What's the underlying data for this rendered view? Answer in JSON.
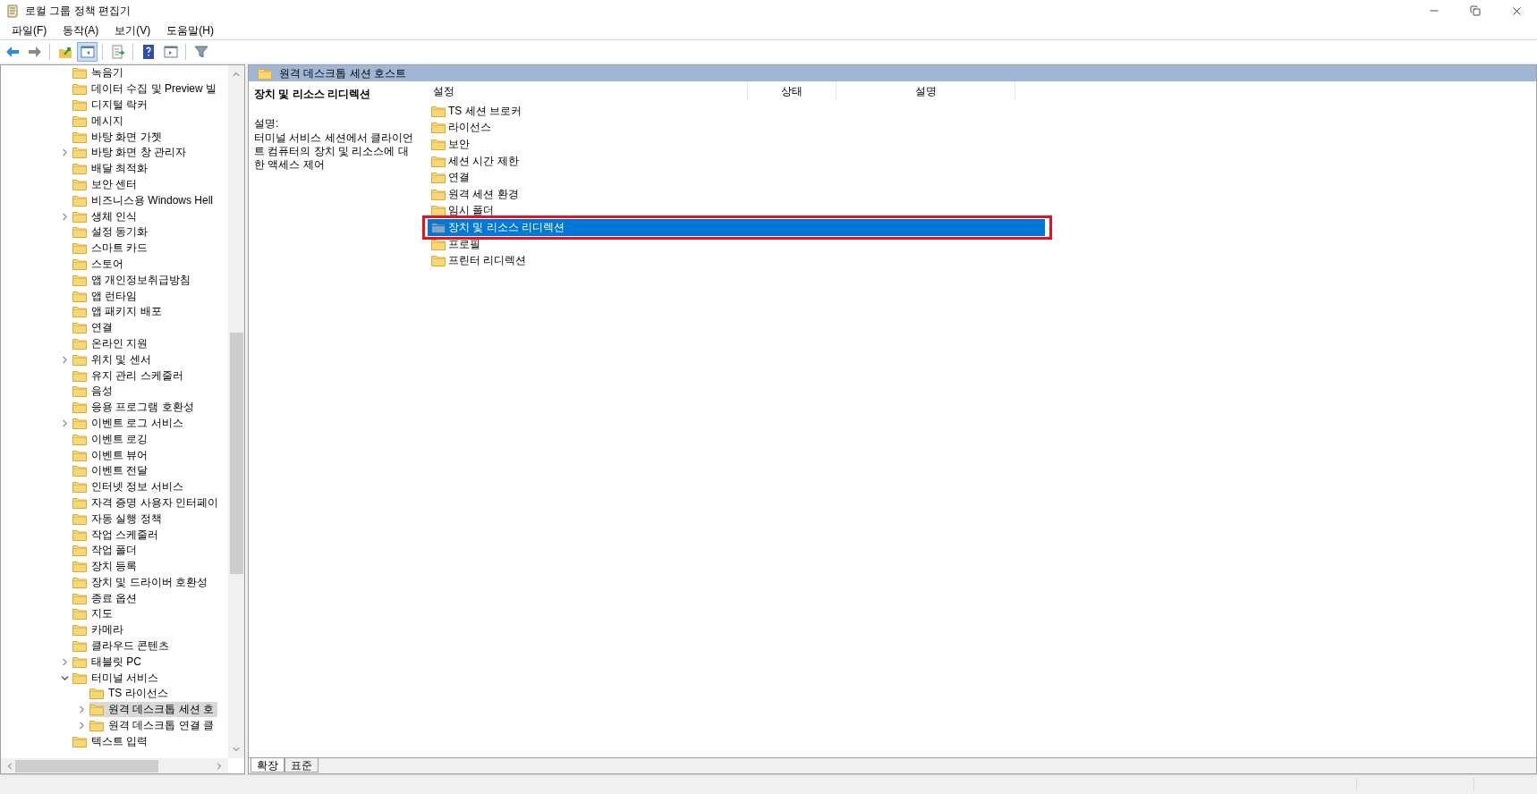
{
  "window": {
    "title": "로컬 그룹 정책 편집기"
  },
  "menu": [
    "파일(F)",
    "동작(A)",
    "보기(V)",
    "도움말(H)"
  ],
  "toolbar": [
    {
      "buttons": [
        {
          "kind": "back",
          "pressed": false
        },
        {
          "kind": "forward",
          "pressed": false
        }
      ]
    },
    {
      "buttons": [
        {
          "kind": "up",
          "pressed": false
        },
        {
          "kind": "tree-pane",
          "pressed": true
        }
      ]
    },
    {
      "buttons": [
        {
          "kind": "export",
          "pressed": false
        }
      ]
    },
    {
      "buttons": [
        {
          "kind": "help",
          "pressed": false
        },
        {
          "kind": "action-pane",
          "pressed": false
        }
      ]
    },
    {
      "buttons": [
        {
          "kind": "filter",
          "pressed": false
        }
      ]
    }
  ],
  "tree": [
    {
      "label": "녹음기",
      "expandable": false,
      "selected": false
    },
    {
      "label": "데이터 수집 및 Preview 빌",
      "expandable": false,
      "selected": false
    },
    {
      "label": "디지털 락커",
      "expandable": false,
      "selected": false
    },
    {
      "label": "메시지",
      "expandable": false,
      "selected": false
    },
    {
      "label": "바탕 화면 가젯",
      "expandable": false,
      "selected": false
    },
    {
      "label": "바탕 화면 창 관리자",
      "expandable": true,
      "expanded": false,
      "selected": false
    },
    {
      "label": "배달 최적화",
      "expandable": false,
      "selected": false
    },
    {
      "label": "보안 센터",
      "expandable": false,
      "selected": false
    },
    {
      "label": "비즈니스용 Windows Hell",
      "expandable": false,
      "selected": false
    },
    {
      "label": "생체 인식",
      "expandable": true,
      "expanded": false,
      "selected": false
    },
    {
      "label": "설정 동기화",
      "expandable": false,
      "selected": false
    },
    {
      "label": "스마트 카드",
      "expandable": false,
      "selected": false
    },
    {
      "label": "스토어",
      "expandable": false,
      "selected": false
    },
    {
      "label": "앱 개인정보취급방침",
      "expandable": false,
      "selected": false
    },
    {
      "label": "앱 런타임",
      "expandable": false,
      "selected": false
    },
    {
      "label": "앱 패키지 배포",
      "expandable": false,
      "selected": false
    },
    {
      "label": "연결",
      "expandable": false,
      "selected": false
    },
    {
      "label": "온라인 지원",
      "expandable": false,
      "selected": false
    },
    {
      "label": "위치 및 센서",
      "expandable": true,
      "expanded": false,
      "selected": false
    },
    {
      "label": "유지 관리 스케줄러",
      "expandable": false,
      "selected": false
    },
    {
      "label": "음성",
      "expandable": false,
      "selected": false
    },
    {
      "label": "응용 프로그램 호환성",
      "expandable": false,
      "selected": false
    },
    {
      "label": "이벤트 로그 서비스",
      "expandable": true,
      "expanded": false,
      "selected": false
    },
    {
      "label": "이벤트 로깅",
      "expandable": false,
      "selected": false
    },
    {
      "label": "이벤트 뷰어",
      "expandable": false,
      "selected": false
    },
    {
      "label": "이벤트 전달",
      "expandable": false,
      "selected": false
    },
    {
      "label": "인터넷 정보 서비스",
      "expandable": false,
      "selected": false
    },
    {
      "label": "자격 증명 사용자 인터페이",
      "expandable": false,
      "selected": false
    },
    {
      "label": "자동 실행 정책",
      "expandable": false,
      "selected": false
    },
    {
      "label": "작업 스케줄러",
      "expandable": false,
      "selected": false
    },
    {
      "label": "작업 폴더",
      "expandable": false,
      "selected": false
    },
    {
      "label": "장치 등록",
      "expandable": false,
      "selected": false
    },
    {
      "label": "장치 및 드라이버 호환성",
      "expandable": false,
      "selected": false
    },
    {
      "label": "종료 옵션",
      "expandable": false,
      "selected": false
    },
    {
      "label": "지도",
      "expandable": false,
      "selected": false
    },
    {
      "label": "카메라",
      "expandable": false,
      "selected": false
    },
    {
      "label": "클라우드 콘텐츠",
      "expandable": false,
      "selected": false
    },
    {
      "label": "태블릿 PC",
      "expandable": true,
      "expanded": false,
      "selected": false
    },
    {
      "label": "터미널 서비스",
      "expandable": true,
      "expanded": true,
      "selected": false,
      "children": [
        {
          "label": "TS 라이선스",
          "expandable": false,
          "selected": false
        },
        {
          "label": "원격 데스크톱 세션 호",
          "expandable": true,
          "expanded": false,
          "selected": true
        },
        {
          "label": "원격 데스크톱 연결 클",
          "expandable": true,
          "expanded": false,
          "selected": false
        }
      ]
    },
    {
      "label": "텍스트 입력",
      "expandable": false,
      "selected": false
    }
  ],
  "header": {
    "title": "원격 데스크톱 세션 호스트"
  },
  "description": {
    "title": "장치 및 리소스 리디렉션",
    "label": "설명:",
    "text": "터미널 서비스 세션에서 클라이언트 컴퓨터의 장치 및 리소스에 대한 액세스 제어"
  },
  "list": {
    "columns": [
      "설정",
      "상태",
      "설명"
    ],
    "rows": [
      {
        "name": "TS 세션 브로커",
        "selected": false,
        "highlighted": false
      },
      {
        "name": "라이선스",
        "selected": false,
        "highlighted": false
      },
      {
        "name": "보안",
        "selected": false,
        "highlighted": false
      },
      {
        "name": "세션 시간 제한",
        "selected": false,
        "highlighted": false
      },
      {
        "name": "연결",
        "selected": false,
        "highlighted": false
      },
      {
        "name": "원격 세션 환경",
        "selected": false,
        "highlighted": false
      },
      {
        "name": "임시 폴더",
        "selected": false,
        "highlighted": false
      },
      {
        "name": "장치 및 리소스 리디렉션",
        "selected": true,
        "highlighted": true
      },
      {
        "name": "프로필",
        "selected": false,
        "highlighted": false
      },
      {
        "name": "프린터 리디렉션",
        "selected": false,
        "highlighted": false
      }
    ]
  },
  "view_tabs": [
    {
      "label": "확장",
      "selected": true
    },
    {
      "label": "표준",
      "selected": false
    }
  ]
}
